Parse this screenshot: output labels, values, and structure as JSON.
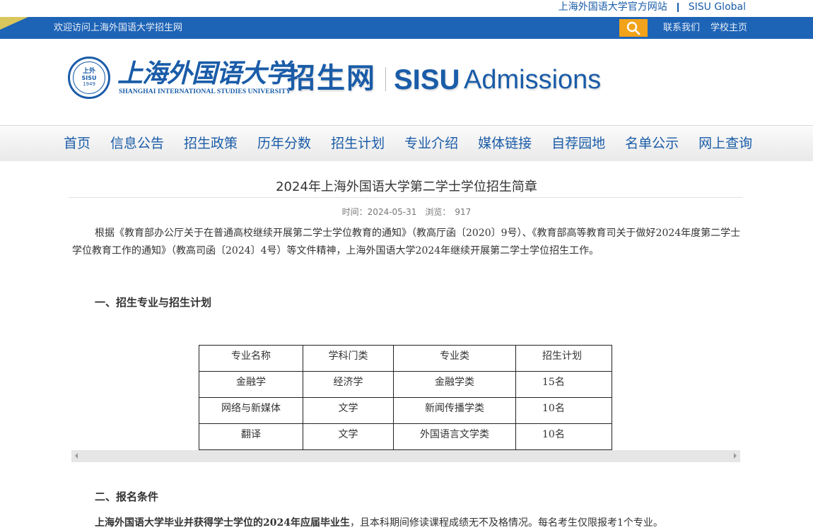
{
  "toplinks": {
    "official": "上海外国语大学官方网站",
    "global": "SISU Global"
  },
  "bluebar": {
    "welcome": "欢迎访问上海外国语大学招生网",
    "contact": "联系我们",
    "school_home": "学校主页"
  },
  "header": {
    "seal_top": "上外",
    "seal_mid": "SISU",
    "seal_year": "1949",
    "university_cn": "上海外国语大学",
    "university_en": "SHANGHAI INTERNATIONAL STUDIES UNIVERSITY",
    "site_name": "招生网",
    "sisu": "SISU",
    "admissions": "Admissions"
  },
  "nav": {
    "items": [
      "首页",
      "信息公告",
      "招生政策",
      "历年分数",
      "招生计划",
      "专业介绍",
      "媒体链接",
      "自荐园地",
      "名单公示",
      "网上查询"
    ]
  },
  "article": {
    "title": "2024年上海外国语大学第二学士学位招生简章",
    "meta": "时间：2024-05-31　浏览：　917",
    "intro": "根据《教育部办公厅关于在普通高校继续开展第二学士学位教育的通知》（教高厅函〔2020〕9号）、《教育部高等教育司关于做好2024年度第二学士学位教育工作的通知》（教高司函〔2024〕4号）等文件精神，上海外国语大学2024年继续开展第二学士学位招生工作。",
    "section1": "一、招生专业与招生计划",
    "section2": "二、报名条件",
    "cond_bold": "上海外国语大学毕业并获得学士学位的2024年应届毕业生",
    "cond_rest": "，且本科期间修读课程成绩无不及格情况。每名考生仅限报考1个专业。"
  },
  "table": {
    "headers": [
      "专业名称",
      "学科门类",
      "专业类",
      "招生计划"
    ],
    "rows": [
      [
        "金融学",
        "经济学",
        "金融学类",
        "15名"
      ],
      [
        "网络与新媒体",
        "文学",
        "新闻传播学类",
        "10名"
      ],
      [
        "翻译",
        "文学",
        "外国语言文学类",
        "10名"
      ]
    ]
  }
}
